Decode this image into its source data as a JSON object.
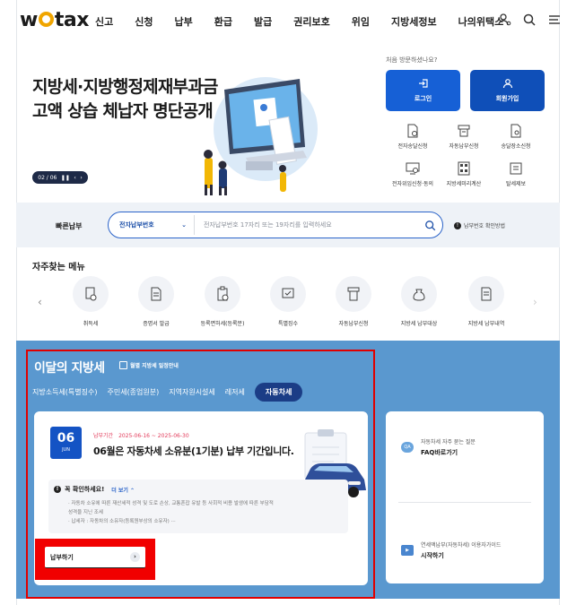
{
  "header": {
    "logo": "wetax",
    "nav": [
      "신고",
      "신청",
      "납부",
      "환급",
      "발급",
      "권리보호",
      "위임",
      "지방세정보",
      "나의위택스"
    ],
    "icons": [
      "user-settings-icon",
      "search-icon",
      "menu-icon"
    ]
  },
  "hero": {
    "title_line1": "지방세·지방행정제재부과금",
    "title_line2": "고액 상습 체납자 명단공개",
    "pager": "02 / 06",
    "visit_text": "처음 방문하셨나요?",
    "login_label": "로그인",
    "join_label": "회원가입"
  },
  "quick_services": [
    {
      "label": "전자송달신청",
      "icon": "document-check-icon"
    },
    {
      "label": "자동납부신청",
      "icon": "printer-icon"
    },
    {
      "label": "송달장소신청",
      "icon": "document-location-icon"
    },
    {
      "label": "전자위임신청·동의",
      "icon": "monitor-icon"
    },
    {
      "label": "지방세미리계산",
      "icon": "calculator-icon"
    },
    {
      "label": "탈세제보",
      "icon": "report-icon"
    }
  ],
  "fast_pay": {
    "label": "빠른납부",
    "select_value": "전자납부번호",
    "placeholder": "전자납부번호 17자리 또는 19자리를 입력하세요",
    "help": "납부번호 확인방법"
  },
  "favorites": {
    "title": "자주찾는 메뉴",
    "items": [
      "취득세",
      "증명서 발급",
      "등록면허세(등록분)",
      "특별징수",
      "자동납부신청",
      "지방세 납부대상",
      "지방세 납부내역"
    ],
    "icons": [
      "house-document-icon",
      "certificate-icon",
      "registration-icon",
      "special-collection-icon",
      "auto-payment-icon",
      "tax-bag-icon",
      "payment-history-icon"
    ]
  },
  "monthly_tax": {
    "title": "이달의 지방세",
    "subtitle": "월별 지방세 일정안내",
    "tabs": [
      "지방소득세(특별징수)",
      "주민세(종업원분)",
      "지역자원시설세",
      "레저세",
      "자동차세"
    ],
    "active_tab": "자동차세",
    "date_day": "06",
    "date_month": "JUN",
    "period_label": "납부기간",
    "period_value": "2025-06-16 ~ 2025-06-30",
    "notice_title": "06월은 자동차세 소유분(1기분) 납부 기간입니다.",
    "check_title": "꼭 확인하세요!",
    "check_more": "더 보기",
    "check_lines": [
      "· 자동차 소유에 따른 재산세적 성격 및 도로 손상, 교통혼잡 유발 등 사회적 비용 발생에 따른 부담적",
      "  성격을 지닌 조세",
      "· 납세자 : 자동차의 소유자(등록원부상의 소유자) ···"
    ],
    "pay_label": "납부하기"
  },
  "side_card": {
    "faq_small": "자동차세 자주 묻는 질문",
    "faq_main": "FAQ바로가기",
    "guide_small": "연세액납부(자동차세) 이용자가이드",
    "guide_main": "시작하기"
  }
}
